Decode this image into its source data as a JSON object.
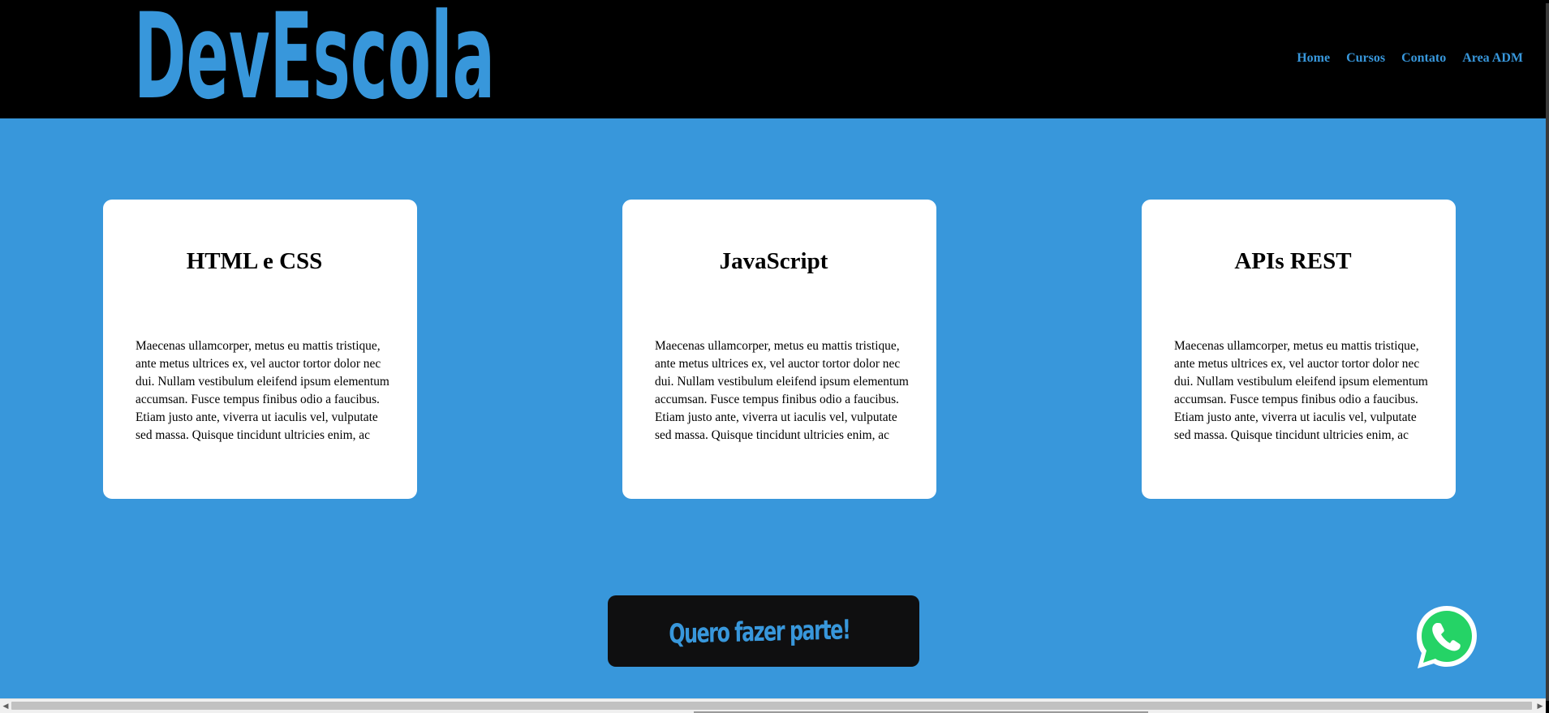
{
  "header": {
    "logo_text": "DevEscola",
    "nav": [
      {
        "label": "Home"
      },
      {
        "label": "Cursos"
      },
      {
        "label": "Contato"
      },
      {
        "label": "Area ADM"
      }
    ]
  },
  "cards": [
    {
      "title": "HTML e CSS",
      "body": "Maecenas ullamcorper, metus eu mattis tristique, ante metus ultrices ex, vel auctor tortor dolor nec dui. Nullam vestibulum eleifend ipsum elementum accumsan. Fusce tempus finibus odio a faucibus. Etiam justo ante, viverra ut iaculis vel, vulputate sed massa. Quisque tincidunt ultricies enim, ac"
    },
    {
      "title": "JavaScript",
      "body": "Maecenas ullamcorper, metus eu mattis tristique, ante metus ultrices ex, vel auctor tortor dolor nec dui. Nullam vestibulum eleifend ipsum elementum accumsan. Fusce tempus finibus odio a faucibus. Etiam justo ante, viverra ut iaculis vel, vulputate sed massa. Quisque tincidunt ultricies enim, ac"
    },
    {
      "title": "APIs REST",
      "body": "Maecenas ullamcorper, metus eu mattis tristique, ante metus ultrices ex, vel auctor tortor dolor nec dui. Nullam vestibulum eleifend ipsum elementum accumsan. Fusce tempus finibus odio a faucibus. Etiam justo ante, viverra ut iaculis vel, vulputate sed massa. Quisque tincidunt ultricies enim, ac"
    }
  ],
  "cta": {
    "label": "Quero fazer parte!"
  },
  "whatsapp": {
    "icon": "whatsapp-icon"
  },
  "colors": {
    "accent": "#3897db",
    "header_bg": "#000000",
    "card_bg": "#ffffff",
    "cta_bg": "#0f0f10",
    "whatsapp_green": "#25d366"
  }
}
